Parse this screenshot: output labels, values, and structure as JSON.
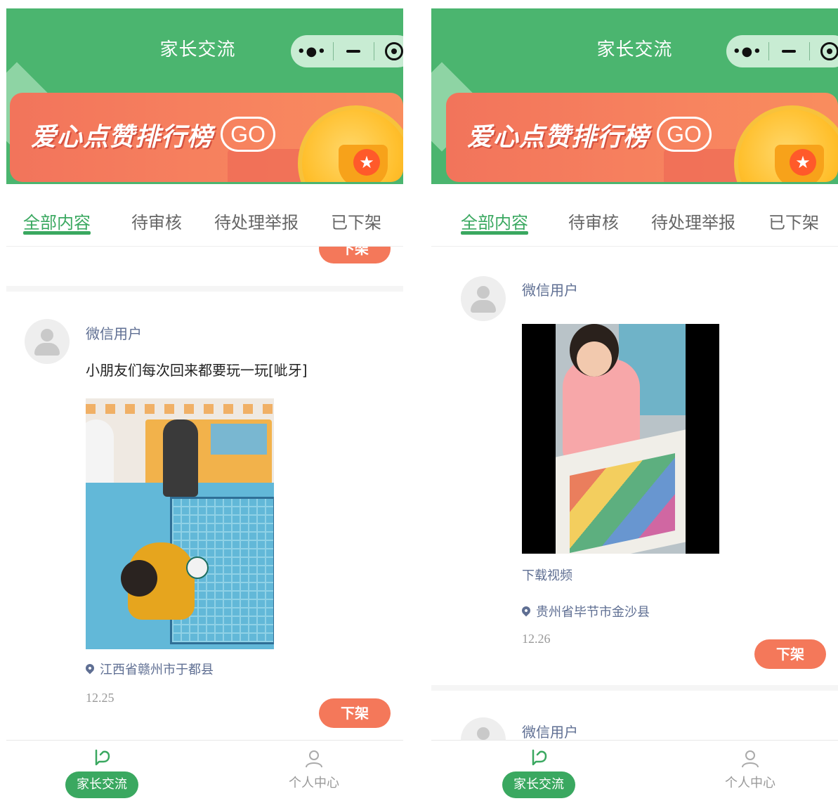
{
  "colors": {
    "primary_green": "#4bb56f",
    "tab_active": "#3aa860",
    "banner_orange": "#f4785a",
    "username_blue": "#5f6f93"
  },
  "header": {
    "title": "家长交流",
    "capsule": {
      "more_icon": "more-dots-icon",
      "minimize_icon": "minimize-icon",
      "close_icon": "target-close-icon"
    }
  },
  "banner": {
    "text": "爱心点赞排行榜",
    "go_label": "GO",
    "icon": "trophy-coin-icon"
  },
  "tabs": [
    {
      "label": "全部内容",
      "active": true
    },
    {
      "label": "待审核",
      "active": false
    },
    {
      "label": "待处理举报",
      "active": false
    },
    {
      "label": "已下架",
      "active": false
    }
  ],
  "left": {
    "partial_button_label": "下架",
    "post": {
      "username": "微信用户",
      "text": "小朋友们每次回来都要玩一玩[呲牙]",
      "location": "江西省赣州市于都县",
      "date": "12.25",
      "action_label": "下架"
    }
  },
  "right": {
    "post": {
      "username": "微信用户",
      "download_label": "下载视频",
      "location": "贵州省毕节市金沙县",
      "date": "12.26",
      "action_label": "下架"
    },
    "next_post": {
      "username": "微信用户"
    }
  },
  "tabbar": {
    "home_label": "家长交流",
    "home_icon": "chat-bubble-icon",
    "profile_label": "个人中心",
    "profile_icon": "person-icon"
  }
}
